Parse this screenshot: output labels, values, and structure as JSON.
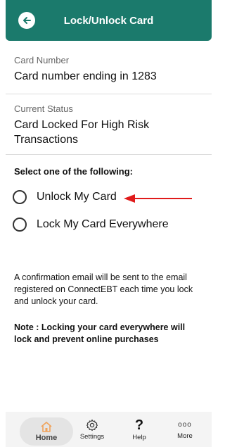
{
  "header": {
    "title": "Lock/Unlock Card",
    "back_icon": "back-arrow-icon"
  },
  "card_number": {
    "label": "Card Number",
    "value": "Card number ending in 1283"
  },
  "current_status": {
    "label": "Current Status",
    "value": "Card Locked For High Risk Transactions"
  },
  "selection": {
    "title": "Select one of the following:",
    "options": [
      {
        "label": "Unlock My Card",
        "selected": false
      },
      {
        "label": "Lock My Card Everywhere",
        "selected": false
      }
    ]
  },
  "info_text": "A confirmation email will be sent to the email registered on ConnectEBT each time you lock and unlock your card.",
  "note_text": "Note : Locking your card everywhere will lock and prevent online purchases",
  "tabbar": {
    "items": [
      {
        "label": "Home",
        "icon": "home-icon",
        "active": true
      },
      {
        "label": "Settings",
        "icon": "gear-icon",
        "active": false
      },
      {
        "label": "Help",
        "icon": "help-icon",
        "active": false
      },
      {
        "label": "More",
        "icon": "more-icon",
        "active": false
      }
    ]
  },
  "colors": {
    "header": "#1b7a6c",
    "home_icon": "#f0a25a",
    "annotation_arrow": "#e01b1b"
  }
}
